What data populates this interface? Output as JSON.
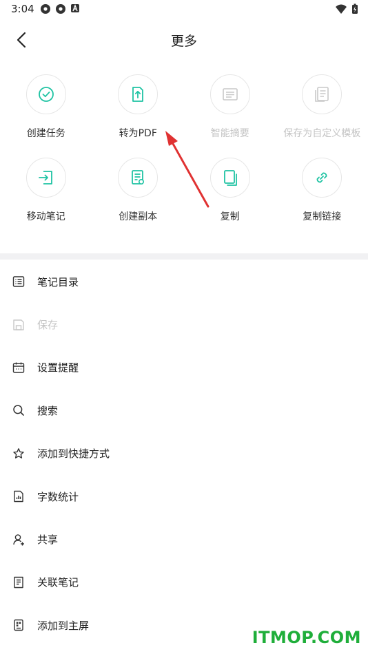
{
  "status_bar": {
    "time": "3:04",
    "left_icons": [
      "settings-gear-icon",
      "settings-gear-icon",
      "a-badge-icon"
    ],
    "right_icons": [
      "wifi-icon",
      "battery-charging-icon"
    ]
  },
  "header": {
    "title": "更多",
    "back_icon": "chevron-left-icon"
  },
  "accent_color": "#1fc3a3",
  "grid": [
    {
      "label": "创建任务",
      "icon": "check-circle-icon",
      "enabled": true
    },
    {
      "label": "转为PDF",
      "icon": "file-export-icon",
      "enabled": true
    },
    {
      "label": "智能摘要",
      "icon": "summary-icon",
      "enabled": false
    },
    {
      "label": "保存为自定义模板",
      "icon": "template-icon",
      "enabled": false
    },
    {
      "label": "移动笔记",
      "icon": "move-note-icon",
      "enabled": true
    },
    {
      "label": "创建副本",
      "icon": "duplicate-icon",
      "enabled": true
    },
    {
      "label": "复制",
      "icon": "copy-icon",
      "enabled": true
    },
    {
      "label": "复制链接",
      "icon": "link-icon",
      "enabled": true
    }
  ],
  "menu": [
    {
      "label": "笔记目录",
      "icon": "list-icon",
      "enabled": true
    },
    {
      "label": "保存",
      "icon": "save-icon",
      "enabled": false
    },
    {
      "label": "设置提醒",
      "icon": "calendar-icon",
      "enabled": true
    },
    {
      "label": "搜索",
      "icon": "search-icon",
      "enabled": true
    },
    {
      "label": "添加到快捷方式",
      "icon": "star-icon",
      "enabled": true
    },
    {
      "label": "字数统计",
      "icon": "word-count-icon",
      "enabled": true
    },
    {
      "label": "共享",
      "icon": "share-user-icon",
      "enabled": true
    },
    {
      "label": "关联笔记",
      "icon": "linked-note-icon",
      "enabled": true
    },
    {
      "label": "添加到主屏",
      "icon": "home-screen-icon",
      "enabled": true
    }
  ],
  "watermark": "ITMOP.COM"
}
